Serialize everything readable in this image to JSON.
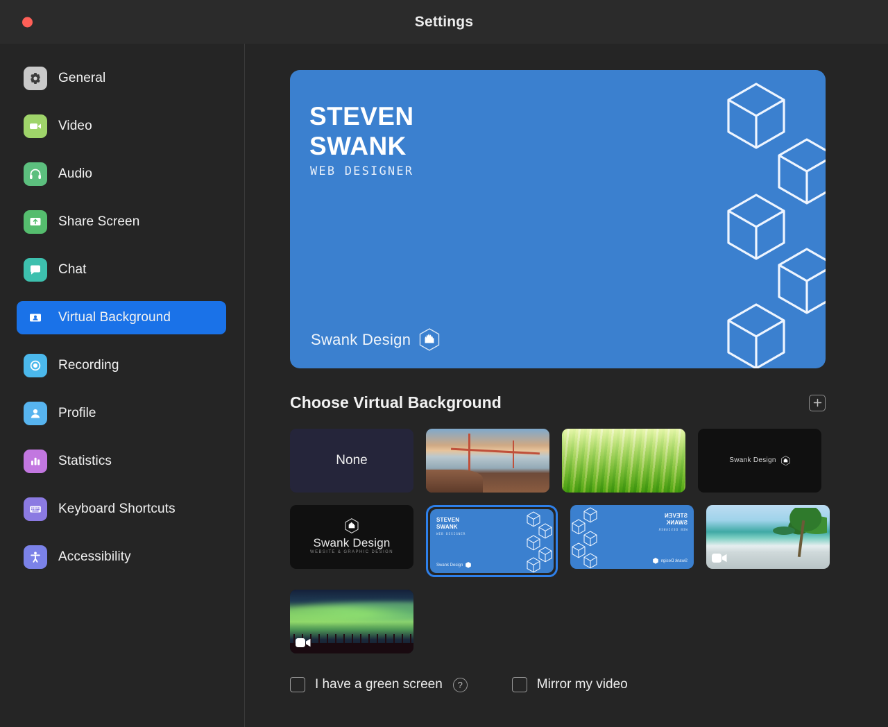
{
  "window": {
    "title": "Settings",
    "traffic_lights": [
      "close"
    ]
  },
  "sidebar": {
    "items": [
      {
        "label": "General",
        "icon": "gear-icon",
        "color": "#c9c9c9",
        "active": false
      },
      {
        "label": "Video",
        "icon": "video-camera-icon",
        "color": "#9fd46a",
        "active": false
      },
      {
        "label": "Audio",
        "icon": "headphones-icon",
        "color": "#5cbf7e",
        "active": false
      },
      {
        "label": "Share Screen",
        "icon": "share-screen-icon",
        "color": "#55bd6e",
        "active": false
      },
      {
        "label": "Chat",
        "icon": "chat-bubble-icon",
        "color": "#3dc0ae",
        "active": false
      },
      {
        "label": "Virtual Background",
        "icon": "person-card-icon",
        "color": "#ffffff",
        "active": true
      },
      {
        "label": "Recording",
        "icon": "record-circle-icon",
        "color": "#4bb8ec",
        "active": false
      },
      {
        "label": "Profile",
        "icon": "person-icon",
        "color": "#57b4ef",
        "active": false
      },
      {
        "label": "Statistics",
        "icon": "bar-chart-icon",
        "color": "#c277e0",
        "active": false
      },
      {
        "label": "Keyboard Shortcuts",
        "icon": "keyboard-icon",
        "color": "#8b7ae2",
        "active": false
      },
      {
        "label": "Accessibility",
        "icon": "accessibility-icon",
        "color": "#7b82e8",
        "active": false
      }
    ]
  },
  "preview": {
    "name_line1": "STEVEN",
    "name_line2": "SWANK",
    "role": "WEB DESIGNER",
    "brand": "Swank Design",
    "background_color": "#3b80cf"
  },
  "section": {
    "title": "Choose Virtual Background",
    "add_label": "+"
  },
  "thumbnails": [
    {
      "kind": "none",
      "label": "None",
      "selected": false,
      "video": false
    },
    {
      "kind": "photo-bridge",
      "label": "",
      "selected": false,
      "video": false
    },
    {
      "kind": "photo-grass",
      "label": "",
      "selected": false,
      "video": false
    },
    {
      "kind": "swank-dark",
      "label": "Swank Design",
      "selected": false,
      "video": false
    },
    {
      "kind": "swank-logo",
      "label": "Swank Design",
      "sublabel": "WEBSITE & GRAPHIC DESIGN",
      "selected": false,
      "video": false
    },
    {
      "kind": "blue-card",
      "label": "STEVEN SWANK",
      "selected": true,
      "video": false
    },
    {
      "kind": "blue-card-mirrored",
      "label": "STEVEN SWANK",
      "selected": false,
      "video": false
    },
    {
      "kind": "photo-beach",
      "label": "",
      "selected": false,
      "video": true
    },
    {
      "kind": "photo-aurora",
      "label": "",
      "selected": false,
      "video": true
    }
  ],
  "mini_card": {
    "name_line1": "STEVEN",
    "name_line2": "SWANK",
    "role": "WEB DESIGNER",
    "brand": "Swank Design"
  },
  "options": {
    "green_screen_label": "I have a green screen",
    "green_screen_checked": false,
    "help_glyph": "?",
    "mirror_label": "Mirror my video",
    "mirror_checked": false
  },
  "colors": {
    "accent": "#1a72e8",
    "selection_ring": "#2e80ea",
    "background": "#252525",
    "titlebar": "#2b2b2b",
    "card_blue": "#3b80cf"
  }
}
